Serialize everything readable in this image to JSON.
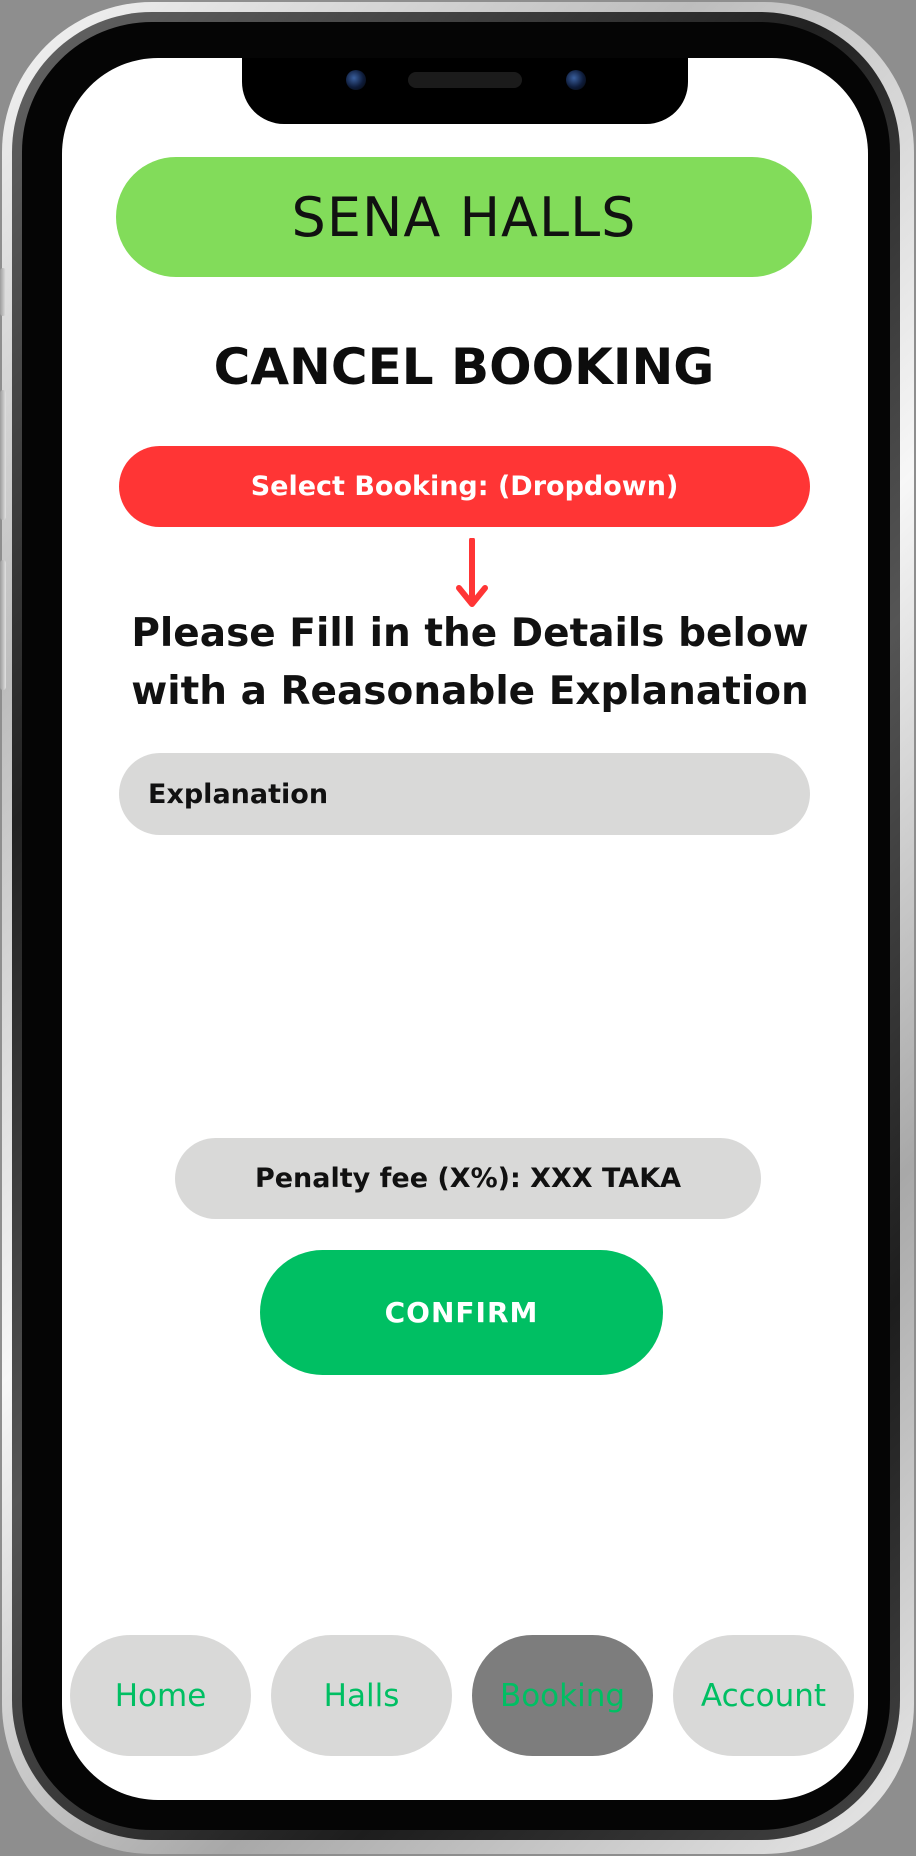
{
  "app": {
    "brand": "SENA HALLS"
  },
  "page": {
    "title": "CANCEL BOOKING"
  },
  "booking_select": {
    "label": "Select Booking: (Dropdown)"
  },
  "instructions": {
    "line1": "Please Fill in the Details below",
    "line2": "with a Reasonable Explanation"
  },
  "explanation": {
    "placeholder": "Explanation",
    "value": ""
  },
  "penalty": {
    "label": "Penalty fee (X%): XXX TAKA"
  },
  "actions": {
    "confirm_label": "CONFIRM"
  },
  "bottom_nav": {
    "items": [
      {
        "label": "Home"
      },
      {
        "label": "Halls"
      },
      {
        "label": "Booking"
      },
      {
        "label": "Account"
      }
    ],
    "active": "Booking"
  },
  "colors": {
    "brand_green": "#82dc5a",
    "danger_red": "#ff3535",
    "action_green": "#00bf63",
    "pill_gray": "#d9d9d8",
    "active_nav_gray": "#7d7d7d"
  },
  "icons": {
    "dropdown_indicator": "arrow-down-icon"
  }
}
